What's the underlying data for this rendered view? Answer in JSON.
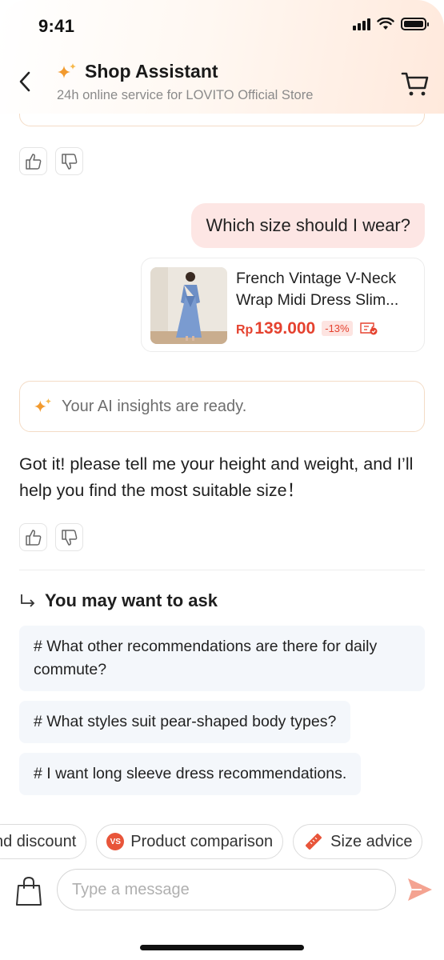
{
  "status": {
    "time": "9:41"
  },
  "header": {
    "title": "Shop Assistant",
    "subtitle": "24h online service for LOVITO Official Store"
  },
  "chat": {
    "user_message": "Which size should I wear?",
    "product": {
      "name_line1": "French Vintage V-Neck",
      "name_line2": "Wrap Midi Dress Slim...",
      "currency": "Rp",
      "price": "139.000",
      "discount": "-13%"
    },
    "ai_ready": "Your AI insights are ready.",
    "bot_reply": "Got it! please tell me your height and weight, and I’ll help you find the most suitable size！",
    "suggest_title": "You may want to ask",
    "suggestions": [
      "# What other recommendations are there for daily commute?",
      "# What styles suit pear-shaped body types?",
      "# I want long sleeve dress recommendations."
    ]
  },
  "quick_actions": [
    {
      "label": "nd discount"
    },
    {
      "label": "Product comparison",
      "badge": "VS"
    },
    {
      "label": "Size advice"
    }
  ],
  "input": {
    "placeholder": "Type a message"
  },
  "colors": {
    "accent": "#e5422f",
    "user_bubble": "#fde6e4",
    "chip_bg": "#f4f7fb",
    "send": "#f4a391"
  }
}
